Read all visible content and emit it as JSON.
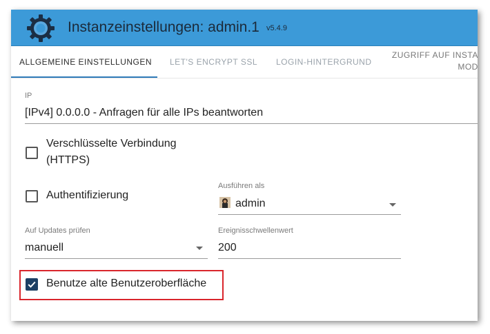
{
  "window": {
    "title": "Instanzeinstellungen: admin.1",
    "version": "v5.4.9",
    "accent": "#3c9ad8"
  },
  "tabs": [
    {
      "label": "ALLGEMEINE EINSTELLUNGEN",
      "active": true
    },
    {
      "label": "LET'S ENCRYPT SSL",
      "active": false
    },
    {
      "label": "LOGIN-HINTERGRUND",
      "active": false
    },
    {
      "label_line1": "ZUGRIFF AUF INSTAN",
      "label_line2": "MODU",
      "active": false
    }
  ],
  "form": {
    "ip": {
      "label": "IP",
      "value": "[IPv4] 0.0.0.0 - Anfragen für alle IPs beantworten"
    },
    "https": {
      "line1": "Verschlüsselte Verbindung",
      "line2": "(HTTPS)",
      "checked": false
    },
    "auth": {
      "label": "Authentifizierung",
      "checked": false
    },
    "run_as": {
      "label": "Ausführen als",
      "value": "admin",
      "icon": "user-avatar-icon"
    },
    "updates": {
      "label": "Auf Updates prüfen",
      "value": "manuell"
    },
    "threshold": {
      "label": "Ereignisschwellenwert",
      "value": "200"
    },
    "legacy_ui": {
      "label": "Benutze alte Benutzeroberfläche",
      "checked": true
    }
  },
  "colors": {
    "tab_indicator": "#2e7ab8",
    "checkbox_checked": "#1c3f64",
    "highlight_border": "#d9252b"
  }
}
